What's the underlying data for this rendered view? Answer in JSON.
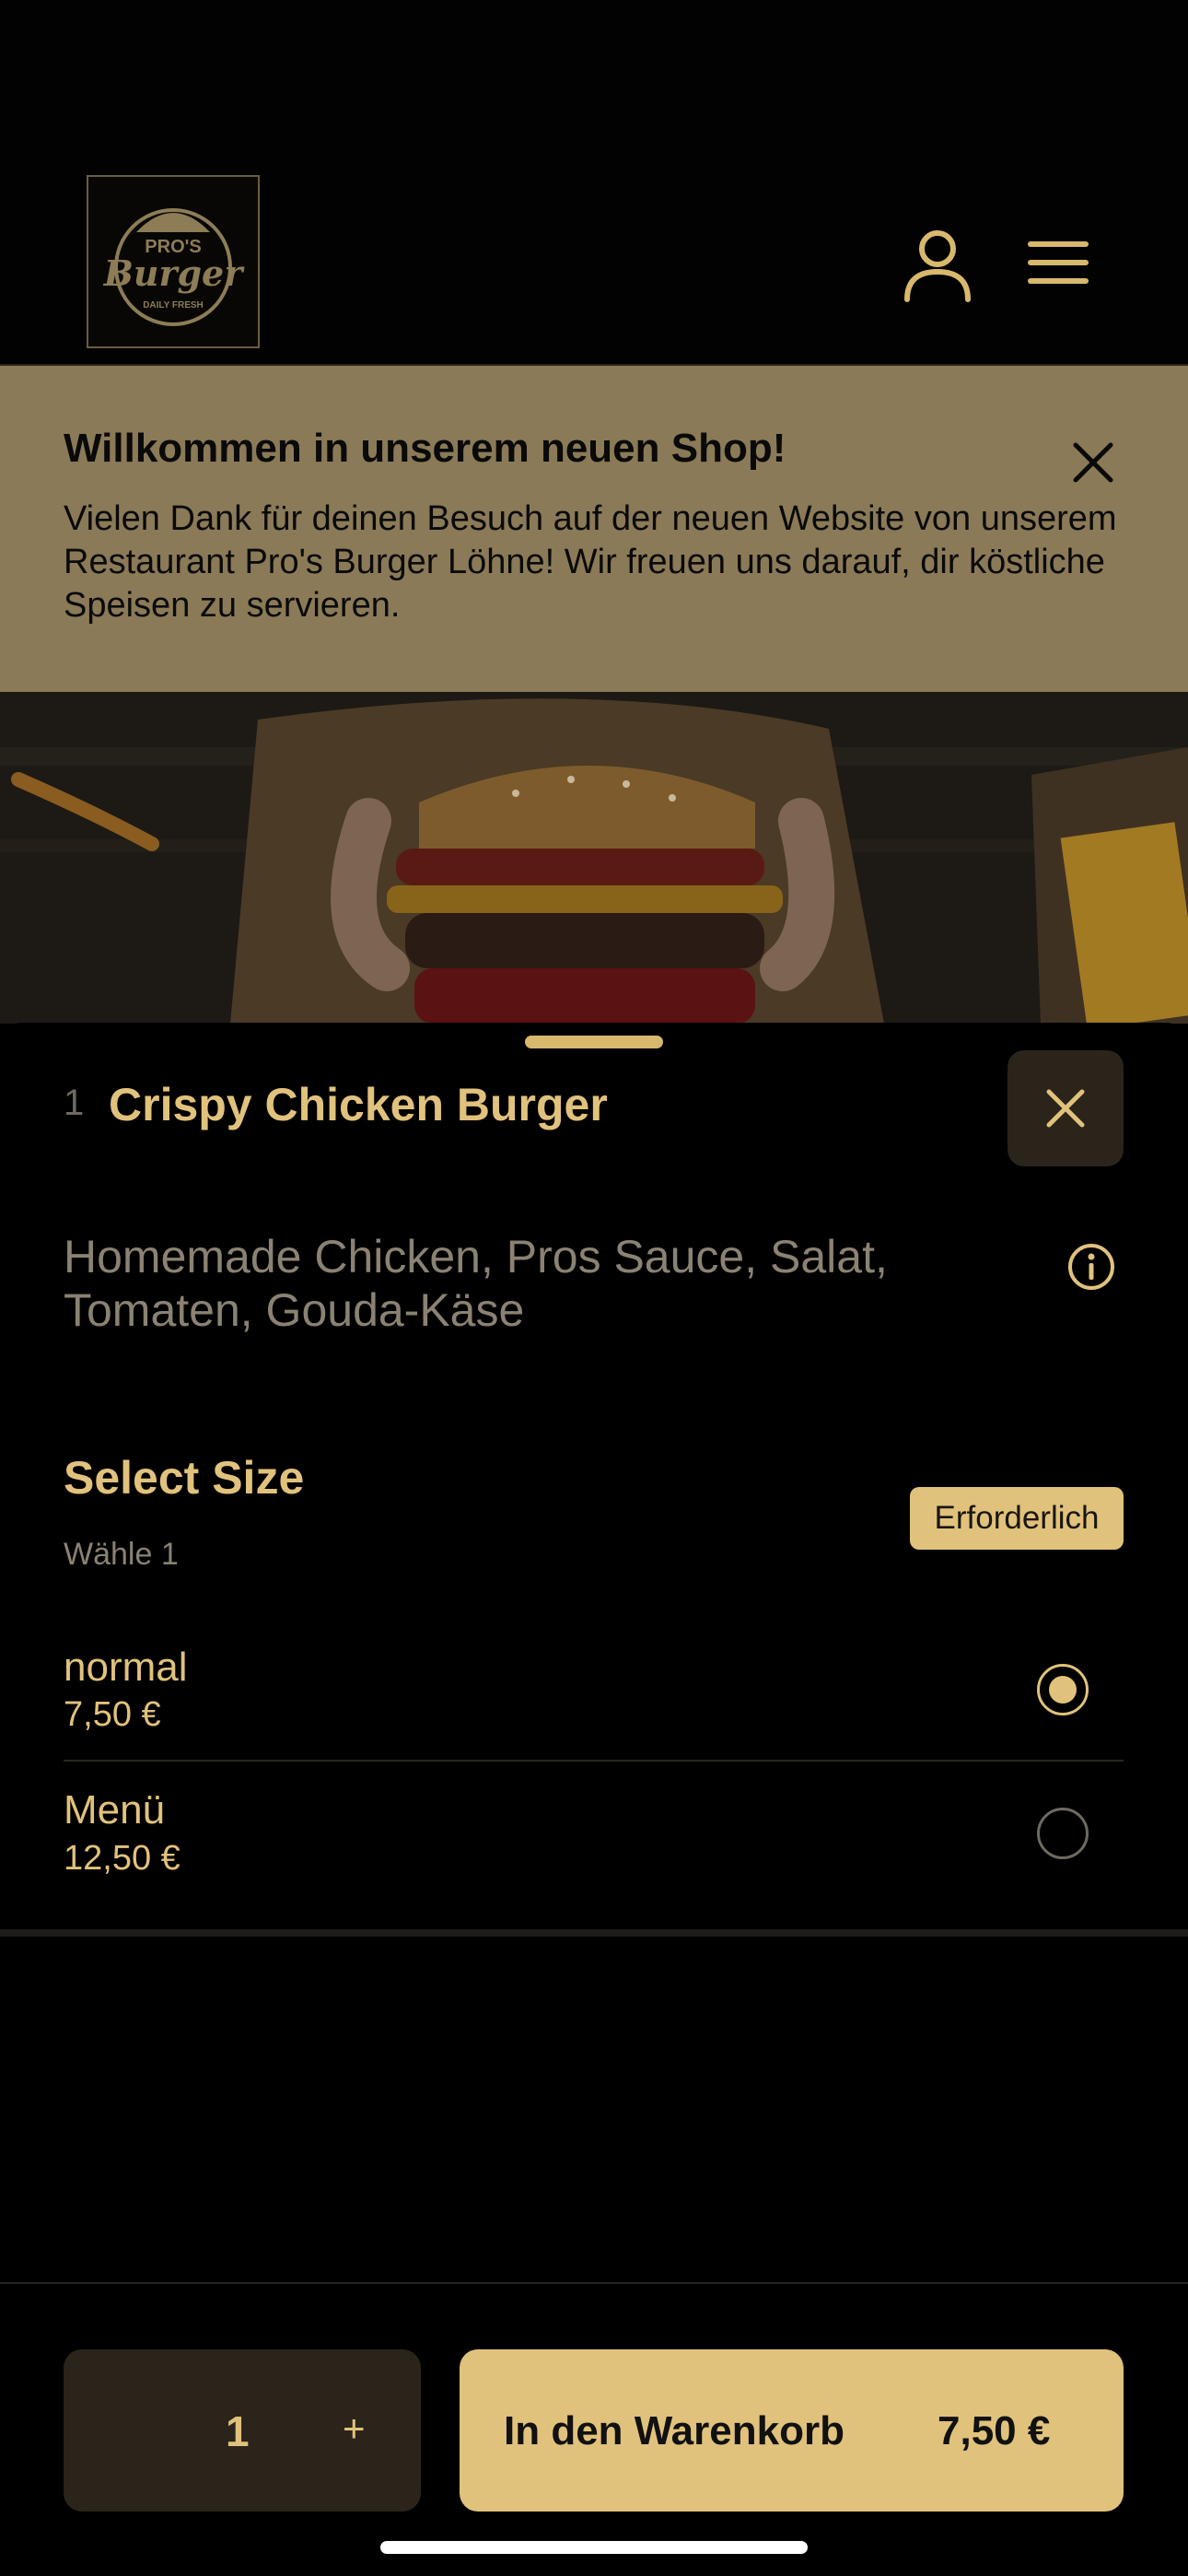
{
  "header": {
    "logo_text_top": "PRO'S",
    "logo_text_main": "Burger",
    "logo_text_bottom": "DAILY FRESH"
  },
  "banner": {
    "title": "Willkommen in unserem neuen Shop!",
    "text": "Vielen Dank für deinen Besuch auf der neuen Website von unserem Restaurant Pro's Burger Löhne! Wir freuen uns darauf, dir köstliche Speisen zu servieren."
  },
  "item": {
    "quantity": "1",
    "title": "Crispy Chicken Burger",
    "description": "Homemade Chicken, Pros Sauce, Salat, Tomaten, Gouda-Käse"
  },
  "size_group": {
    "title": "Select Size",
    "subtitle": "Wähle 1",
    "badge": "Erforderlich",
    "options": [
      {
        "name": "normal",
        "price": "7,50 €",
        "selected": true
      },
      {
        "name": "Menü",
        "price": "12,50 €",
        "selected": false
      }
    ]
  },
  "footer": {
    "quantity": "1",
    "plus_label": "+",
    "add_label": "In den Warenkorb",
    "add_price": "7,50 €"
  },
  "colors": {
    "accent": "#e1c27c",
    "banner_bg": "#8b7a57",
    "dark_button": "#2a241a"
  }
}
